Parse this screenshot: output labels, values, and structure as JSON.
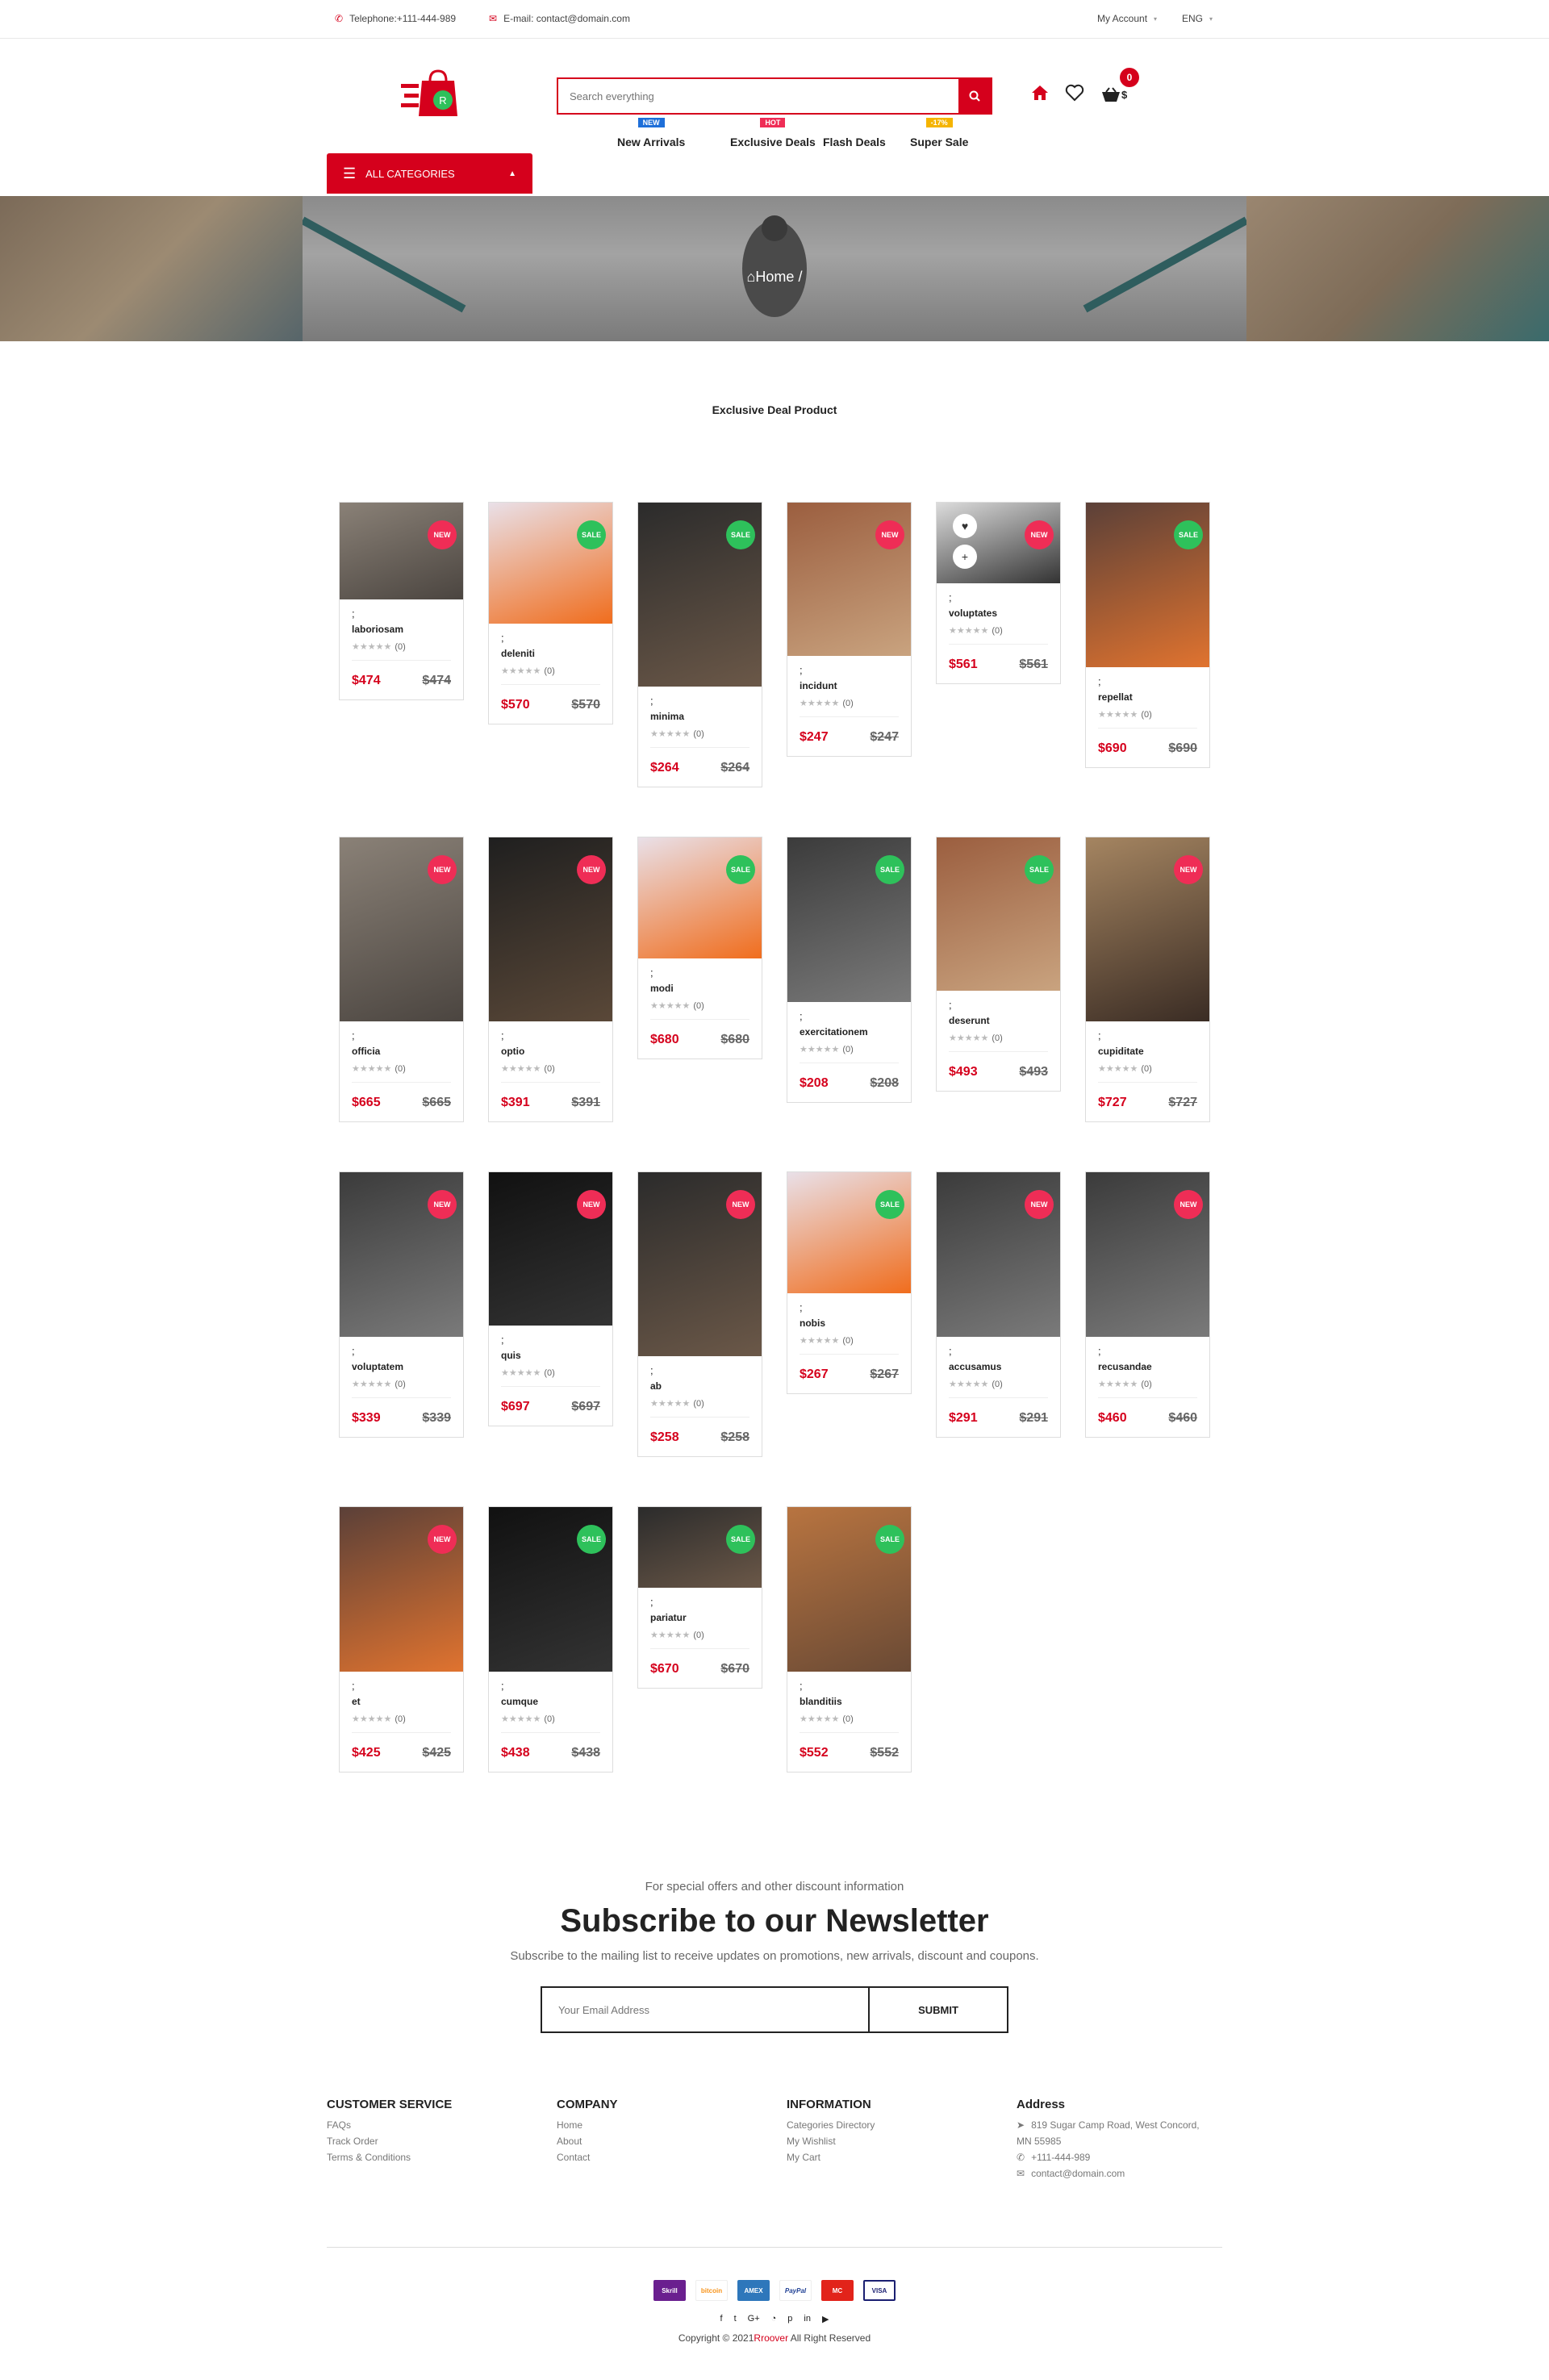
{
  "topbar": {
    "telephone": "Telephone:+111-444-989",
    "email": "E-mail: contact@domain.com",
    "account": "My Account",
    "language": "ENG"
  },
  "header": {
    "search_placeholder": "Search everything",
    "cart_count": "0",
    "cart_suffix": "$",
    "all_categories": "ALL CATEGORIES"
  },
  "nav": [
    {
      "label": "New Arrivals",
      "tag": "NEW",
      "tag_color": "#1e6fd9"
    },
    {
      "label": "Exclusive Deals",
      "tag": "HOT",
      "tag_color": "#ef2d56"
    },
    {
      "label": "Flash Deals",
      "tag": "",
      "tag_color": ""
    },
    {
      "label": "Super Sale",
      "tag": "-17%",
      "tag_color": "#f5b400"
    }
  ],
  "breadcrumb": "Home /",
  "section_title": "Exclusive Deal Product",
  "products": [
    {
      "name": "laboriosam",
      "badge": "NEW",
      "rating": "(0)",
      "price": "$474",
      "old": "$474"
    },
    {
      "name": "deleniti",
      "badge": "SALE",
      "rating": "(0)",
      "price": "$570",
      "old": "$570"
    },
    {
      "name": "minima",
      "badge": "SALE",
      "rating": "(0)",
      "price": "$264",
      "old": "$264"
    },
    {
      "name": "incidunt",
      "badge": "NEW",
      "rating": "(0)",
      "price": "$247",
      "old": "$247"
    },
    {
      "name": "voluptates",
      "badge": "NEW",
      "rating": "(0)",
      "price": "$561",
      "old": "$561"
    },
    {
      "name": "repellat",
      "badge": "SALE",
      "rating": "(0)",
      "price": "$690",
      "old": "$690"
    },
    {
      "name": "officia",
      "badge": "NEW",
      "rating": "(0)",
      "price": "$665",
      "old": "$665"
    },
    {
      "name": "optio",
      "badge": "NEW",
      "rating": "(0)",
      "price": "$391",
      "old": "$391"
    },
    {
      "name": "modi",
      "badge": "SALE",
      "rating": "(0)",
      "price": "$680",
      "old": "$680"
    },
    {
      "name": "exercitationem",
      "badge": "SALE",
      "rating": "(0)",
      "price": "$208",
      "old": "$208"
    },
    {
      "name": "deserunt",
      "badge": "SALE",
      "rating": "(0)",
      "price": "$493",
      "old": "$493"
    },
    {
      "name": "cupiditate",
      "badge": "NEW",
      "rating": "(0)",
      "price": "$727",
      "old": "$727"
    },
    {
      "name": "voluptatem",
      "badge": "NEW",
      "rating": "(0)",
      "price": "$339",
      "old": "$339"
    },
    {
      "name": "quis",
      "badge": "NEW",
      "rating": "(0)",
      "price": "$697",
      "old": "$697"
    },
    {
      "name": "ab",
      "badge": "NEW",
      "rating": "(0)",
      "price": "$258",
      "old": "$258"
    },
    {
      "name": "nobis",
      "badge": "SALE",
      "rating": "(0)",
      "price": "$267",
      "old": "$267"
    },
    {
      "name": "accusamus",
      "badge": "NEW",
      "rating": "(0)",
      "price": "$291",
      "old": "$291"
    },
    {
      "name": "recusandae",
      "badge": "NEW",
      "rating": "(0)",
      "price": "$460",
      "old": "$460"
    },
    {
      "name": "et",
      "badge": "NEW",
      "rating": "(0)",
      "price": "$425",
      "old": "$425"
    },
    {
      "name": "cumque",
      "badge": "SALE",
      "rating": "(0)",
      "price": "$438",
      "old": "$438"
    },
    {
      "name": "pariatur",
      "badge": "SALE",
      "rating": "(0)",
      "price": "$670",
      "old": "$670"
    },
    {
      "name": "blanditiis",
      "badge": "SALE",
      "rating": "(0)",
      "price": "$552",
      "old": "$552"
    }
  ],
  "newsletter": {
    "subtitle": "For special offers and other discount information",
    "title": "Subscribe to our Newsletter",
    "description": "Subscribe to the mailing list to receive updates on promotions, new arrivals, discount and coupons.",
    "placeholder": "Your Email Address",
    "submit": "SUBMIT"
  },
  "footer": {
    "customer_service": {
      "title": "CUSTOMER SERVICE",
      "links": [
        "FAQs",
        "Track Order",
        "Terms & Conditions"
      ]
    },
    "company": {
      "title": "COMPANY",
      "links": [
        "Home",
        "About",
        "Contact"
      ]
    },
    "information": {
      "title": "INFORMATION",
      "links": [
        "Categories Directory",
        "My Wishlist",
        "My Cart"
      ]
    },
    "address": {
      "title": "Address",
      "street": "819 Sugar Camp Road, West Concord,",
      "city": "MN 55985",
      "phone": "+111-444-989",
      "email": "contact@domain.com"
    }
  },
  "payments": [
    "Skrill",
    "bitcoin",
    "AMEX",
    "PayPal",
    "MC",
    "VISA"
  ],
  "copyright_pre": "Copyright © 2021",
  "copyright_brand": "Rroover",
  "copyright_post": " All Right Reserved",
  "colors": {
    "accent": "#d5001c",
    "new_badge": "#ef2d56",
    "sale_badge": "#2ec15b"
  }
}
